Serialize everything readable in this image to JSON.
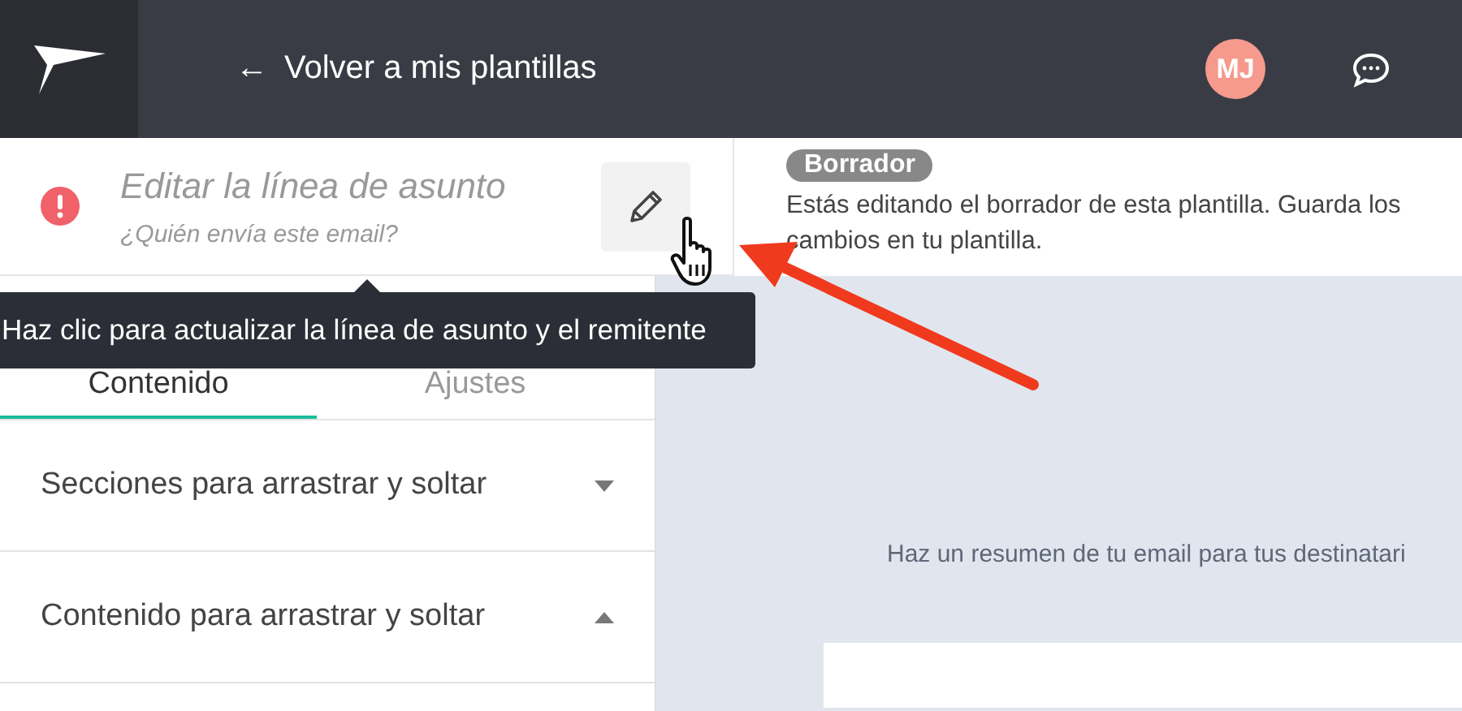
{
  "header": {
    "back_link": "Volver a mis plantillas",
    "back_icon": "←",
    "avatar": "MJ"
  },
  "subject": {
    "title": "Editar la línea de asunto",
    "sender": "¿Quién envía este email?"
  },
  "tooltip": "Haz clic para actualizar la línea de asunto y el remitente",
  "draft": {
    "badge": "Borrador",
    "message": "Estás editando el borrador de esta plantilla. Guarda los cambios en tu plantilla."
  },
  "tabs": [
    {
      "label": "Contenido",
      "selected": true
    },
    {
      "label": "Ajustes",
      "selected": false
    }
  ],
  "sections": [
    {
      "label": "Secciones para arrastrar y soltar",
      "expanded": false
    },
    {
      "label": "Contenido para arrastrar y soltar",
      "expanded": true
    }
  ],
  "canvas": {
    "preheader": "Haz un resumen de tu email para tus destinatari"
  }
}
